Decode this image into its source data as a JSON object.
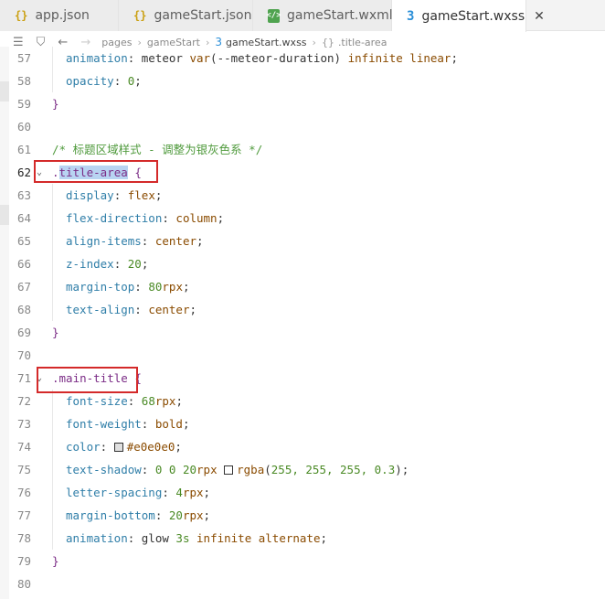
{
  "tabs": [
    {
      "label": "app.json",
      "icon": "{}",
      "type": "json-icon"
    },
    {
      "label": "gameStart.json",
      "icon": "{}",
      "type": "json-icon"
    },
    {
      "label": "gameStart.wxml",
      "icon": "</>",
      "type": "wxml-icon"
    },
    {
      "label": "gameStart.wxss",
      "icon": "3",
      "type": "css-icon",
      "close": "✕"
    }
  ],
  "breadcrumb": {
    "items": [
      "pages",
      "gameStart",
      "gameStart.wxss",
      ".title-area"
    ]
  },
  "lines": [
    {
      "n": "57",
      "indent": true,
      "parts": [
        [
          "prop",
          "animation"
        ],
        [
          "plain",
          ": meteor "
        ],
        [
          "val",
          "var"
        ],
        [
          "plain",
          "(--meteor-duration) "
        ],
        [
          "val",
          "infinite linear"
        ],
        [
          "plain",
          ";"
        ]
      ]
    },
    {
      "n": "58",
      "indent": true,
      "parts": [
        [
          "prop",
          "opacity"
        ],
        [
          "plain",
          ": "
        ],
        [
          "num",
          "0"
        ],
        [
          "plain",
          ";"
        ]
      ]
    },
    {
      "n": "59",
      "indent": false,
      "parts": [
        [
          "brace",
          "}"
        ]
      ]
    },
    {
      "n": "60",
      "indent": false,
      "parts": []
    },
    {
      "n": "61",
      "indent": false,
      "parts": [
        [
          "comment",
          "/* 标题区域样式 - 调整为银灰色系 */"
        ]
      ]
    },
    {
      "n": "62",
      "indent": false,
      "fold": true,
      "parts": [
        [
          "sel",
          "."
        ],
        [
          "selhl",
          "title-area"
        ],
        [
          "plain",
          " "
        ],
        [
          "brace",
          "{"
        ]
      ]
    },
    {
      "n": "63",
      "indent": true,
      "parts": [
        [
          "prop",
          "display"
        ],
        [
          "plain",
          ": "
        ],
        [
          "val",
          "flex"
        ],
        [
          "plain",
          ";"
        ]
      ]
    },
    {
      "n": "64",
      "indent": true,
      "parts": [
        [
          "prop",
          "flex-direction"
        ],
        [
          "plain",
          ": "
        ],
        [
          "val",
          "column"
        ],
        [
          "plain",
          ";"
        ]
      ]
    },
    {
      "n": "65",
      "indent": true,
      "parts": [
        [
          "prop",
          "align-items"
        ],
        [
          "plain",
          ": "
        ],
        [
          "val",
          "center"
        ],
        [
          "plain",
          ";"
        ]
      ]
    },
    {
      "n": "66",
      "indent": true,
      "parts": [
        [
          "prop",
          "z-index"
        ],
        [
          "plain",
          ": "
        ],
        [
          "num",
          "20"
        ],
        [
          "plain",
          ";"
        ]
      ]
    },
    {
      "n": "67",
      "indent": true,
      "parts": [
        [
          "prop",
          "margin-top"
        ],
        [
          "plain",
          ": "
        ],
        [
          "num",
          "80"
        ],
        [
          "val",
          "rpx"
        ],
        [
          "plain",
          ";"
        ]
      ]
    },
    {
      "n": "68",
      "indent": true,
      "parts": [
        [
          "prop",
          "text-align"
        ],
        [
          "plain",
          ": "
        ],
        [
          "val",
          "center"
        ],
        [
          "plain",
          ";"
        ]
      ]
    },
    {
      "n": "69",
      "indent": false,
      "parts": [
        [
          "brace",
          "}"
        ]
      ]
    },
    {
      "n": "70",
      "indent": false,
      "parts": []
    },
    {
      "n": "71",
      "indent": false,
      "fold": true,
      "parts": [
        [
          "sel",
          ".main-title"
        ],
        [
          "plain",
          " "
        ],
        [
          "brace",
          "{"
        ]
      ]
    },
    {
      "n": "72",
      "indent": true,
      "parts": [
        [
          "prop",
          "font-size"
        ],
        [
          "plain",
          ": "
        ],
        [
          "num",
          "68"
        ],
        [
          "val",
          "rpx"
        ],
        [
          "plain",
          ";"
        ]
      ]
    },
    {
      "n": "73",
      "indent": true,
      "parts": [
        [
          "prop",
          "font-weight"
        ],
        [
          "plain",
          ": "
        ],
        [
          "val",
          "bold"
        ],
        [
          "plain",
          ";"
        ]
      ]
    },
    {
      "n": "74",
      "indent": true,
      "parts": [
        [
          "prop",
          "color"
        ],
        [
          "plain",
          ": "
        ],
        [
          "swatch",
          "#e0e0e0"
        ],
        [
          "val",
          "#e0e0e0"
        ],
        [
          "plain",
          ";"
        ]
      ]
    },
    {
      "n": "75",
      "indent": true,
      "parts": [
        [
          "prop",
          "text-shadow"
        ],
        [
          "plain",
          ": "
        ],
        [
          "num",
          "0 0 20"
        ],
        [
          "val",
          "rpx "
        ],
        [
          "swatch",
          "#ffffff"
        ],
        [
          "val",
          "rgba"
        ],
        [
          "plain",
          "("
        ],
        [
          "num",
          "255, 255, 255, 0.3"
        ],
        [
          "plain",
          ");"
        ]
      ]
    },
    {
      "n": "76",
      "indent": true,
      "parts": [
        [
          "prop",
          "letter-spacing"
        ],
        [
          "plain",
          ": "
        ],
        [
          "num",
          "4"
        ],
        [
          "val",
          "rpx"
        ],
        [
          "plain",
          ";"
        ]
      ]
    },
    {
      "n": "77",
      "indent": true,
      "parts": [
        [
          "prop",
          "margin-bottom"
        ],
        [
          "plain",
          ": "
        ],
        [
          "num",
          "20"
        ],
        [
          "val",
          "rpx"
        ],
        [
          "plain",
          ";"
        ]
      ]
    },
    {
      "n": "78",
      "indent": true,
      "parts": [
        [
          "prop",
          "animation"
        ],
        [
          "plain",
          ": glow "
        ],
        [
          "num",
          "3s"
        ],
        [
          "plain",
          " "
        ],
        [
          "val",
          "infinite alternate"
        ],
        [
          "plain",
          ";"
        ]
      ]
    },
    {
      "n": "79",
      "indent": false,
      "parts": [
        [
          "brace",
          "}"
        ]
      ]
    },
    {
      "n": "80",
      "indent": false,
      "parts": []
    }
  ]
}
